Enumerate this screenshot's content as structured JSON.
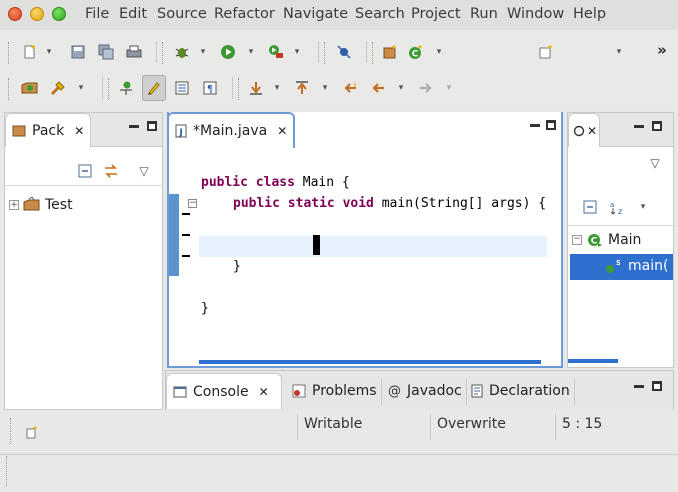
{
  "menubar": {
    "items": [
      "File",
      "Edit",
      "Source",
      "Refactor",
      "Navigate",
      "Search",
      "Project",
      "Run",
      "Window",
      "Help"
    ]
  },
  "toolbar": {
    "overflow": "»"
  },
  "package_explorer": {
    "tab_label": "Pack",
    "tree": [
      {
        "label": "Test"
      }
    ]
  },
  "editor": {
    "tab_label": "*Main.java",
    "lines": [
      {
        "kw": "public class",
        "text": " Main {"
      },
      {
        "kw": "public static void",
        "text": " main(String[] args) {"
      },
      {
        "kw": "",
        "text": ""
      },
      {
        "kw": "",
        "text": "}"
      },
      {
        "kw": "",
        "text": ""
      },
      {
        "kw": "",
        "text": "}"
      }
    ]
  },
  "outline": {
    "tree": [
      {
        "label": "Main"
      },
      {
        "label": "main("
      }
    ]
  },
  "bottom_panel": {
    "tabs": [
      "Console",
      "Problems",
      "Javadoc",
      "Declaration"
    ]
  },
  "status": {
    "writable": "Writable",
    "mode": "Overwrite",
    "position": "5 : 15"
  },
  "colors": {
    "keyword": "#7f0055",
    "selection": "#2f6fcd",
    "editor_border": "#6e9bd6"
  }
}
